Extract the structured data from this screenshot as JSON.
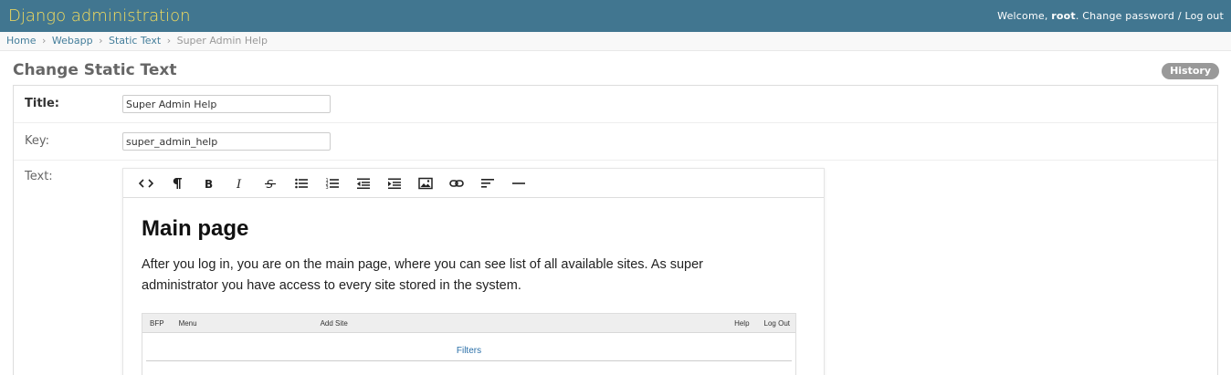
{
  "header": {
    "site_name": "Django administration",
    "welcome": "Welcome, ",
    "username": "root",
    "change_password": "Change password",
    "separator": " / ",
    "log_out": "Log out"
  },
  "breadcrumbs": {
    "items": [
      "Home",
      "Webapp",
      "Static Text"
    ],
    "current": "Super Admin Help",
    "separator": "›"
  },
  "page": {
    "title": "Change Static Text",
    "history_label": "History"
  },
  "form": {
    "title_label": "Title:",
    "title_value": "Super Admin Help",
    "key_label": "Key:",
    "key_value": "super_admin_help",
    "text_label": "Text:"
  },
  "toolbar": {
    "buttons": [
      "code-view",
      "paragraph",
      "bold",
      "italic",
      "strikethrough",
      "unordered-list",
      "ordered-list",
      "outdent",
      "indent",
      "image",
      "link",
      "align",
      "horizontal-rule"
    ]
  },
  "editor": {
    "heading": "Main page",
    "paragraph": "After you log in, you are on the main page, where you can see list of all available sites. As super administrator you have access to every site stored in the system.",
    "embedded_screenshot": {
      "nav_bfp": "BFP",
      "nav_menu": "Menu",
      "nav_add_site": "Add Site",
      "nav_help": "Help",
      "nav_logout": "Log Out",
      "filters": "Filters"
    }
  },
  "colors": {
    "header_bg": "#417690",
    "site_name": "#f5dd5d",
    "link": "#447e9b",
    "history_bg": "#999999"
  }
}
